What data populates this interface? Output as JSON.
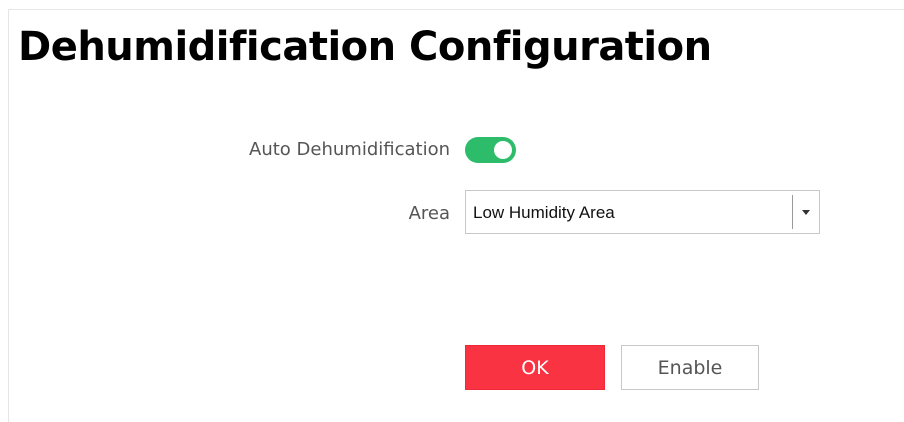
{
  "page": {
    "title": "Dehumidification Configuration"
  },
  "form": {
    "auto_dehumidification": {
      "label": "Auto Dehumidification",
      "enabled": true,
      "toggle_color": "#2dbc6a"
    },
    "area": {
      "label": "Area",
      "selected": "Low Humidity Area"
    }
  },
  "actions": {
    "ok_label": "OK",
    "enable_label": "Enable",
    "ok_color": "#fa3343"
  },
  "icons": {
    "dropdown": "chevron-down-icon"
  }
}
